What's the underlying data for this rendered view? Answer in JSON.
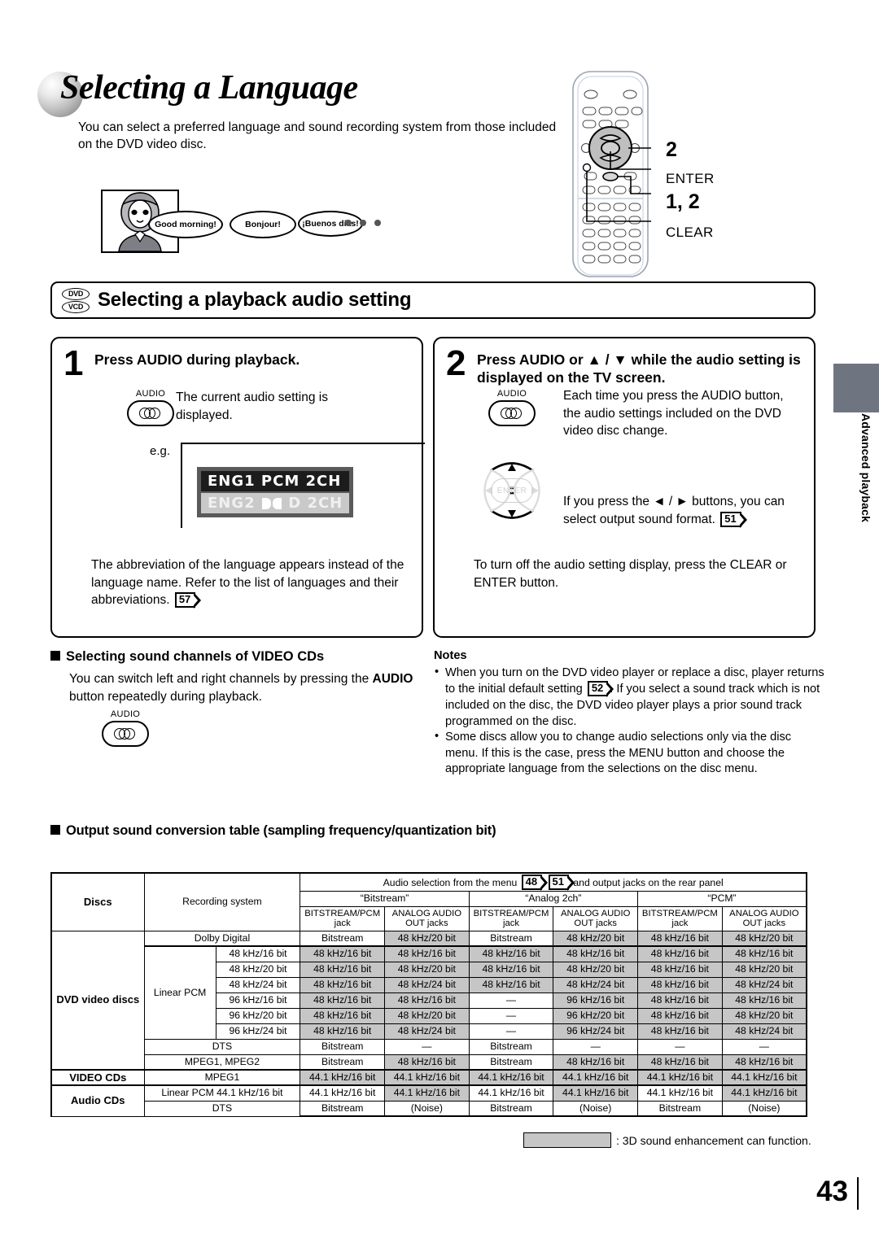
{
  "page": {
    "title": "Selecting a Language",
    "intro": "You can select a preferred language and sound recording system from those included on the DVD video disc.",
    "number": "43",
    "side_tab": "Advanced playback"
  },
  "illustration": {
    "bubbles": [
      "Good morning!",
      "Bonjour!",
      "¡Buenos días!"
    ],
    "ellipsis": "• • •"
  },
  "remote_callouts": {
    "enter_num": "2",
    "enter_label": "ENTER",
    "clear_num": "1, 2",
    "clear_label": "CLEAR"
  },
  "section": {
    "badge_dvd": "DVD",
    "badge_vcd": "VCD",
    "title": "Selecting a playback audio setting"
  },
  "steps": [
    {
      "num": "1",
      "heading": "Press AUDIO during playback.",
      "button_caption": "AUDIO",
      "body": "The current audio setting is displayed.",
      "eg_label": "e.g.",
      "osd_line1": "ENG1 PCM 2CH",
      "osd_line2_pre": "ENG2",
      "osd_line2_post": "D 2CH",
      "footer_pre": "The abbreviation of the language appears instead of the language name. Refer to the list of languages and their abbreviations.",
      "footer_pgref": "57"
    },
    {
      "num": "2",
      "heading": "Press AUDIO or ▲ / ▼ while the audio setting is displayed on the TV screen.",
      "button_caption": "AUDIO",
      "body": "Each time you press the AUDIO button, the audio settings included on the DVD video disc change.",
      "body2_pre": "If you press the ◄ / ► buttons, you can select output sound format.",
      "body2_pgref": "51",
      "pad_center": "ENTER",
      "footer": "To turn off the audio setting display, press the CLEAR or ENTER button."
    }
  ],
  "videocd_section": {
    "heading": "Selecting sound channels of VIDEO CDs",
    "body_pre": "You can switch left and right channels by pressing the ",
    "body_bold": "AUDIO",
    "body_post": " button repeatedly during playback.",
    "button_caption": "AUDIO"
  },
  "notes": {
    "heading": "Notes",
    "items": [
      {
        "pre": "When you turn on the DVD video player or replace a disc, player returns to the initial default setting ",
        "pgref": "52",
        "post": ". If you select a sound track which is not included on the disc, the DVD video player plays a prior sound track programmed on the disc."
      },
      {
        "pre": "Some discs allow you to change audio selections only via the disc menu.  If this is the case, press the MENU button and choose the appropriate language from the selections on the disc menu.",
        "pgref": "",
        "post": ""
      }
    ]
  },
  "table": {
    "heading": "Output sound conversion table (sampling frequency/quantization bit)",
    "col_discs": "Discs",
    "col_recsys": "Recording system",
    "banner_pre": "Audio selection from the menu",
    "banner_ref1": "48",
    "banner_ref2": "51",
    "banner_post": "and output jacks on the rear panel",
    "groups": [
      "“Bitstream”",
      "“Analog 2ch”",
      "“PCM”"
    ],
    "jack_a_l1": "BITSTREAM/PCM",
    "jack_a_l2": "jack",
    "jack_b_l1": "ANALOG AUDIO",
    "jack_b_l2": "OUT jacks",
    "disc_groups": [
      {
        "name": "DVD video discs",
        "rows": 9
      },
      {
        "name": "VIDEO CDs",
        "rows": 1
      },
      {
        "name": "Audio CDs",
        "rows": 2
      }
    ],
    "rows": [
      {
        "sys": "Dolby Digital",
        "sub": "",
        "span": "full",
        "cells": [
          "Bitstream",
          "48 kHz/20 bit",
          "Bitstream",
          "48 kHz/20 bit",
          "48 kHz/16 bit",
          "48 kHz/20 bit"
        ],
        "shade": [
          false,
          true,
          false,
          true,
          true,
          true
        ]
      },
      {
        "sys": "Linear PCM",
        "sub": "48 kHz/16 bit",
        "span": "split",
        "cells": [
          "48 kHz/16 bit",
          "48 kHz/16 bit",
          "48 kHz/16 bit",
          "48 kHz/16 bit",
          "48 kHz/16 bit",
          "48 kHz/16 bit"
        ],
        "shade": [
          true,
          true,
          true,
          true,
          true,
          true
        ]
      },
      {
        "sys": "",
        "sub": "48 kHz/20 bit",
        "span": "split",
        "cells": [
          "48 kHz/16 bit",
          "48 kHz/20 bit",
          "48 kHz/16 bit",
          "48 kHz/20 bit",
          "48 kHz/16 bit",
          "48 kHz/20 bit"
        ],
        "shade": [
          true,
          true,
          true,
          true,
          true,
          true
        ]
      },
      {
        "sys": "",
        "sub": "48 kHz/24 bit",
        "span": "split",
        "cells": [
          "48 kHz/16 bit",
          "48 kHz/24 bit",
          "48 kHz/16 bit",
          "48 kHz/24 bit",
          "48 kHz/16 bit",
          "48 kHz/24 bit"
        ],
        "shade": [
          true,
          true,
          true,
          true,
          true,
          true
        ]
      },
      {
        "sys": "",
        "sub": "96 kHz/16 bit",
        "span": "split",
        "cells": [
          "48 kHz/16 bit",
          "48 kHz/16 bit",
          "—",
          "96 kHz/16 bit",
          "48 kHz/16 bit",
          "48 kHz/16 bit"
        ],
        "shade": [
          true,
          true,
          false,
          true,
          true,
          true
        ]
      },
      {
        "sys": "",
        "sub": "96 kHz/20 bit",
        "span": "split",
        "cells": [
          "48 kHz/16 bit",
          "48 kHz/20 bit",
          "—",
          "96 kHz/20 bit",
          "48 kHz/16 bit",
          "48 kHz/20 bit"
        ],
        "shade": [
          true,
          true,
          false,
          true,
          true,
          true
        ]
      },
      {
        "sys": "",
        "sub": "96 kHz/24 bit",
        "span": "split",
        "cells": [
          "48 kHz/16 bit",
          "48 kHz/24 bit",
          "—",
          "96 kHz/24 bit",
          "48 kHz/16 bit",
          "48 kHz/24 bit"
        ],
        "shade": [
          true,
          true,
          false,
          true,
          true,
          true
        ]
      },
      {
        "sys": "DTS",
        "sub": "",
        "span": "full",
        "cells": [
          "Bitstream",
          "—",
          "Bitstream",
          "—",
          "—",
          "—"
        ],
        "shade": [
          false,
          false,
          false,
          false,
          false,
          false
        ]
      },
      {
        "sys": "MPEG1, MPEG2",
        "sub": "",
        "span": "full",
        "cells": [
          "Bitstream",
          "48 kHz/16 bit",
          "Bitstream",
          "48 kHz/16 bit",
          "48 kHz/16 bit",
          "48 kHz/16 bit"
        ],
        "shade": [
          false,
          true,
          false,
          true,
          true,
          true
        ]
      },
      {
        "sys": "MPEG1",
        "sub": "",
        "span": "full",
        "cells": [
          "44.1 kHz/16 bit",
          "44.1 kHz/16 bit",
          "44.1 kHz/16 bit",
          "44.1 kHz/16 bit",
          "44.1 kHz/16 bit",
          "44.1 kHz/16 bit"
        ],
        "shade": [
          true,
          true,
          true,
          true,
          true,
          true
        ]
      },
      {
        "sys": "Linear PCM 44.1 kHz/16 bit",
        "sub": "",
        "span": "full",
        "cells": [
          "44.1 kHz/16 bit",
          "44.1 kHz/16 bit",
          "44.1 kHz/16 bit",
          "44.1 kHz/16 bit",
          "44.1 kHz/16 bit",
          "44.1 kHz/16 bit"
        ],
        "shade": [
          false,
          true,
          false,
          true,
          false,
          true
        ]
      },
      {
        "sys": "DTS",
        "sub": "",
        "span": "full",
        "cells": [
          "Bitstream",
          "(Noise)",
          "Bitstream",
          "(Noise)",
          "Bitstream",
          "(Noise)"
        ],
        "shade": [
          false,
          false,
          false,
          false,
          false,
          false
        ]
      }
    ],
    "legend": ": 3D sound enhancement can function."
  }
}
